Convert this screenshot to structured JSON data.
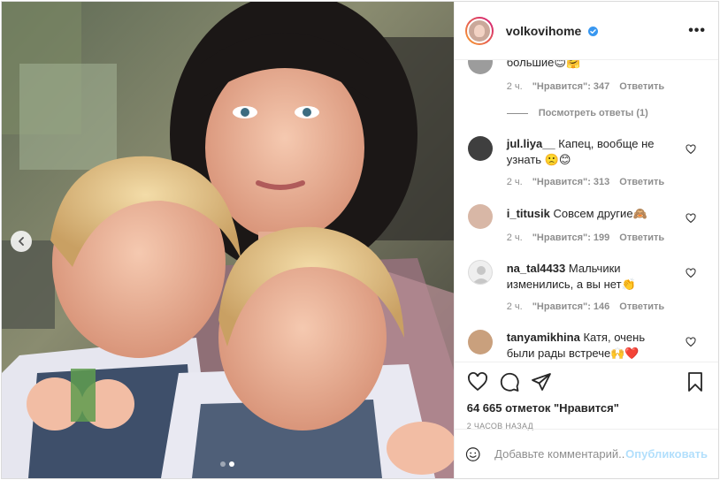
{
  "header": {
    "username": "volkovihome",
    "more_label": "•••"
  },
  "comments": [
    {
      "text": "большие😊🤗",
      "time": "2 ч.",
      "likes": "\"Нравится\": 347",
      "reply": "Ответить"
    },
    {
      "view_replies": "Посмотреть ответы (1)"
    },
    {
      "user": "jul.liya__",
      "text": "Капец, вообще не узнать 🙁😊",
      "time": "2 ч.",
      "likes": "\"Нравится\": 313",
      "reply": "Ответить"
    },
    {
      "user": "i_titusik",
      "text": "Совсем другие🙈",
      "time": "2 ч.",
      "likes": "\"Нравится\": 199",
      "reply": "Ответить"
    },
    {
      "user": "na_tal4433",
      "text": "Мальчики изменились, а вы нет👏",
      "time": "2 ч.",
      "likes": "\"Нравится\": 146",
      "reply": "Ответить"
    },
    {
      "user": "tanyamikhina",
      "text": "Катя, очень были рады встрече🙌❤️ Мальчишки"
    }
  ],
  "post": {
    "likes": "64 665 отметок \"Нравится\"",
    "date": "2 ЧАСОВ НАЗАД"
  },
  "add_comment": {
    "placeholder": "Добавьте комментарий...",
    "publish": "Опубликовать"
  },
  "colors": {
    "accent": "#0095f6",
    "publish_disabled": "#b2dffc",
    "secondary": "#8e8e8e"
  },
  "icons": [
    "chevron-left-icon",
    "heart-icon",
    "comment-icon",
    "share-icon",
    "bookmark-icon",
    "emoji-icon",
    "verified-icon",
    "more-icon"
  ]
}
